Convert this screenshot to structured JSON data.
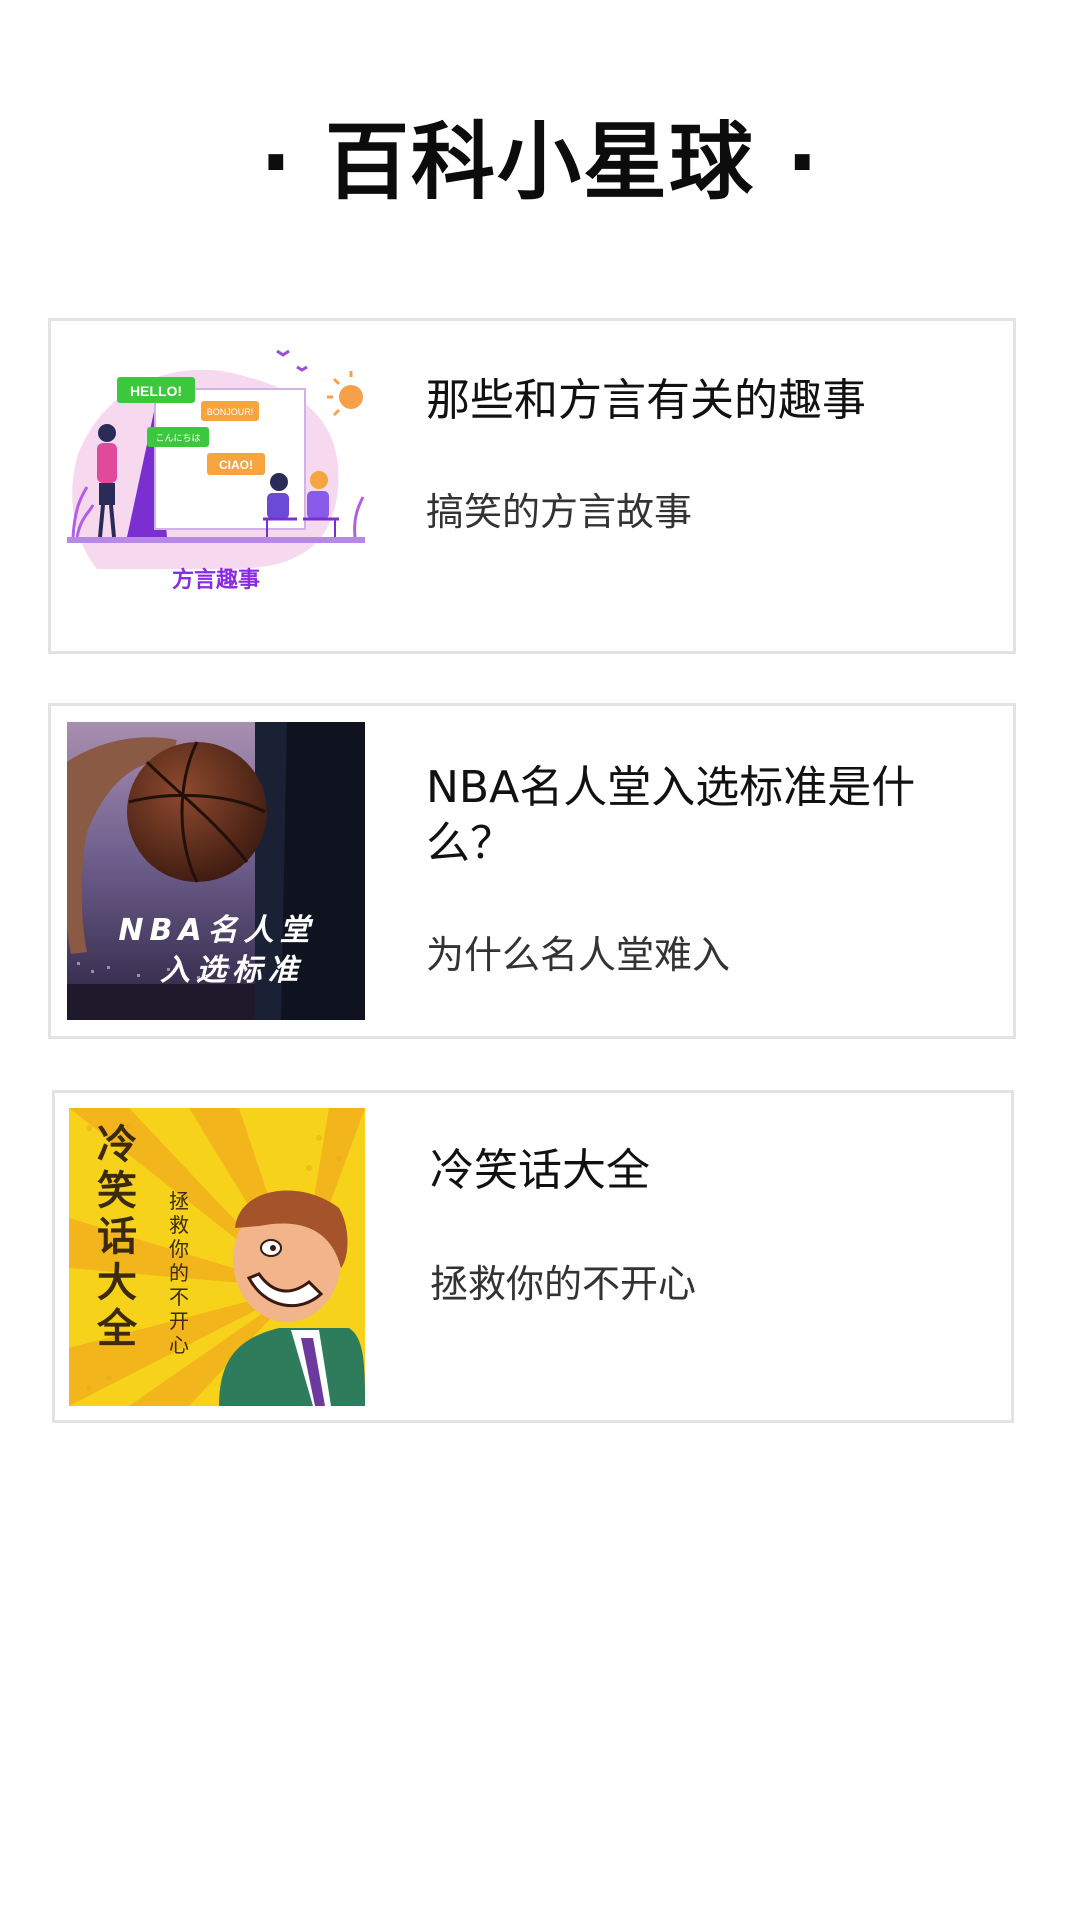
{
  "header": {
    "title": "· 百科小星球 ·"
  },
  "cards": [
    {
      "title": "那些和方言有关的趣事",
      "subtitle": "搞笑的方言故事",
      "image": {
        "label": "方言趣事",
        "bubbles": [
          "HELLO!",
          "BONJOUR!",
          "こんにちは",
          "CIAO!"
        ]
      }
    },
    {
      "title": "NBA名人堂入选标准是什么？",
      "subtitle": "为什么名人堂难入",
      "image": {
        "line1": "NBA名人堂",
        "line2": "入选标准"
      }
    },
    {
      "title": "冷笑话大全",
      "subtitle": "拯救你的不开心",
      "image": {
        "vertical_title": [
          "冷",
          "笑",
          "话",
          "大",
          "全"
        ],
        "vertical_sub": [
          "拯",
          "救",
          "你",
          "的",
          "不",
          "开",
          "心"
        ]
      }
    }
  ],
  "colors": {
    "card_border": "#e3e3e3",
    "purple": "#8a2be2",
    "yellow": "#f7d21a"
  }
}
